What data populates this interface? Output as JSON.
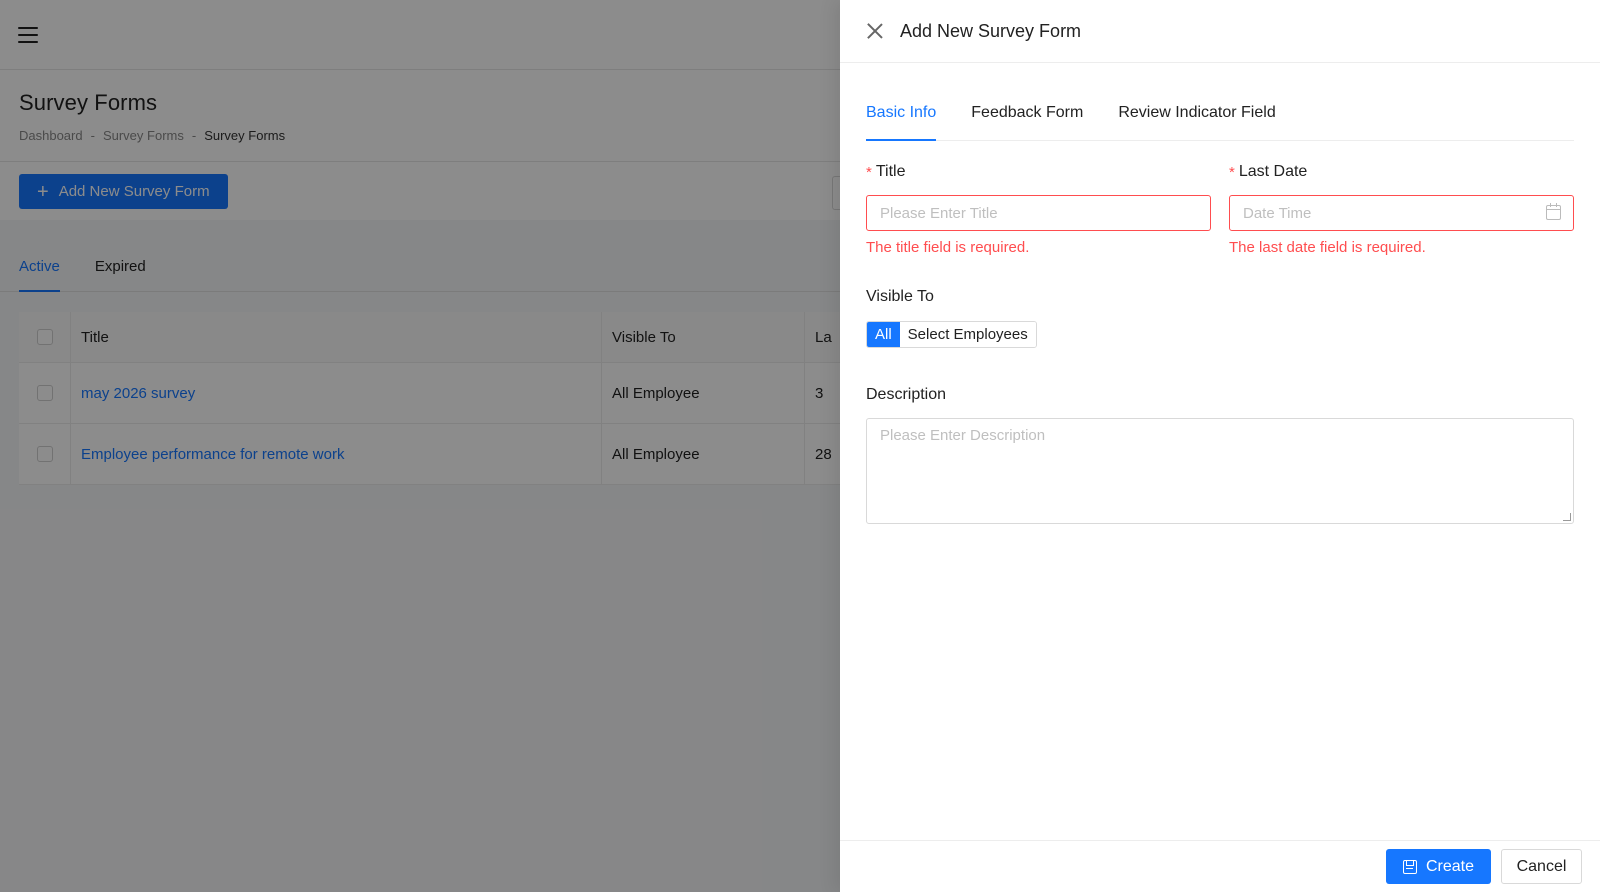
{
  "page": {
    "title": "Survey Forms",
    "breadcrumb": [
      "Dashboard",
      "-",
      "Survey Forms",
      "-",
      "Survey Forms"
    ],
    "add_button_label": "Add New Survey Form",
    "tabs": [
      {
        "label": "Active",
        "active": true
      },
      {
        "label": "Expired",
        "active": false
      }
    ],
    "table": {
      "headers": [
        "Title",
        "Visible To",
        "La"
      ],
      "rows": [
        {
          "title": "may 2026 survey",
          "visible_to": "All Employee",
          "last_date": "3"
        },
        {
          "title": "Employee performance for remote work",
          "visible_to": "All Employee",
          "last_date": "28"
        }
      ]
    }
  },
  "drawer": {
    "title": "Add New Survey Form",
    "tabs": [
      {
        "label": "Basic Info",
        "active": true
      },
      {
        "label": "Feedback Form",
        "active": false
      },
      {
        "label": "Review Indicator Field",
        "active": false
      }
    ],
    "required_mark": "*",
    "title_field": {
      "label": "Title",
      "placeholder": "Please Enter Title",
      "value": "",
      "error": "The title field is required."
    },
    "last_date_field": {
      "label": "Last Date",
      "placeholder": "Date Time",
      "value": "",
      "error": "The last date field is required."
    },
    "visible_to": {
      "label": "Visible To",
      "options": [
        "All",
        "Select Employees"
      ],
      "selected": "All"
    },
    "description": {
      "label": "Description",
      "placeholder": "Please Enter Description",
      "value": ""
    },
    "footer": {
      "create_label": "Create",
      "cancel_label": "Cancel"
    }
  },
  "colors": {
    "primary": "#1677ff",
    "error": "#ff4d4f",
    "overlay": "rgba(0,0,0,0.45)"
  },
  "icons": [
    "menu-icon",
    "plus-icon",
    "close-icon",
    "calendar-icon",
    "save-icon"
  ]
}
